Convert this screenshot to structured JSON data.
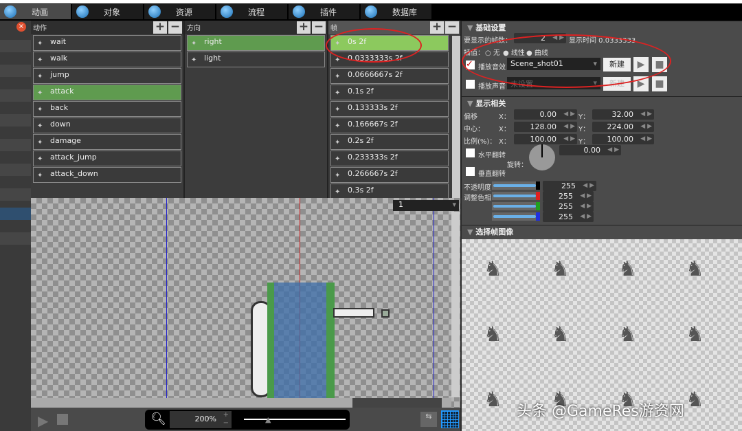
{
  "tabs": [
    {
      "label": "动画",
      "icon": "animation-icon",
      "selected": true
    },
    {
      "label": "对象",
      "icon": "object-icon"
    },
    {
      "label": "资源",
      "icon": "resource-icon"
    },
    {
      "label": "流程",
      "icon": "flow-icon"
    },
    {
      "label": "插件",
      "icon": "plugin-icon"
    },
    {
      "label": "数据库",
      "icon": "database-icon"
    }
  ],
  "actions": {
    "title": "动作",
    "items": [
      "wait",
      "walk",
      "jump",
      "attack",
      "back",
      "down",
      "damage",
      "attack_jump",
      "attack_down"
    ],
    "selected": 3
  },
  "directions": {
    "title": "方向",
    "items": [
      "right",
      "light"
    ],
    "selected": 0
  },
  "frames": {
    "title": "帧",
    "items": [
      "0s 2f",
      "0.0333333s 2f",
      "0.0666667s 2f",
      "0.1s 2f",
      "0.133333s 2f",
      "0.166667s 2f",
      "0.2s 2f",
      "0.233333s 2f",
      "0.266667s 2f",
      "0.3s 2f"
    ],
    "selected": 0
  },
  "canvas": {
    "layer_select": "1",
    "zoom": "200%"
  },
  "basic": {
    "title": "基础设置",
    "frames_label": "要显示的帧数：",
    "frames_value": "2",
    "time_label": "显示时间 0.0333333",
    "interp_label": "插值：",
    "interp_options": [
      "无",
      "线性",
      "曲线"
    ],
    "interp_selected": "无",
    "sound_effect_label": "播放音效",
    "sound_effect_checked": true,
    "sound_effect_value": "Scene_shot01",
    "new_label": "新建",
    "voice_label": "播放声音",
    "voice_checked": false,
    "voice_value": "未设置"
  },
  "display": {
    "title": "显示相关",
    "offset_label": "偏移",
    "center_label": "中心：",
    "scale_label": "比例(%)：",
    "x_label": "X：",
    "y_label": "Y：",
    "offset_x": "0.00",
    "offset_y": "32.00",
    "center_x": "128.00",
    "center_y": "224.00",
    "scale_x": "100.00",
    "scale_y": "100.00",
    "hflip_label": "水平翻转",
    "vflip_label": "垂直翻转",
    "rotate_label": "旋转：",
    "rotate_value": "0.00",
    "opacity_label": "不透明度",
    "hue_label": "调整色相",
    "opacity": "255",
    "r": "255",
    "g": "255",
    "b": "255",
    "slider_colors": [
      "#000000",
      "#e02020",
      "#20a020",
      "#2030e0"
    ]
  },
  "frame_image": {
    "title": "选择帧图像"
  },
  "watermark": "头条 @GameRes游资网"
}
